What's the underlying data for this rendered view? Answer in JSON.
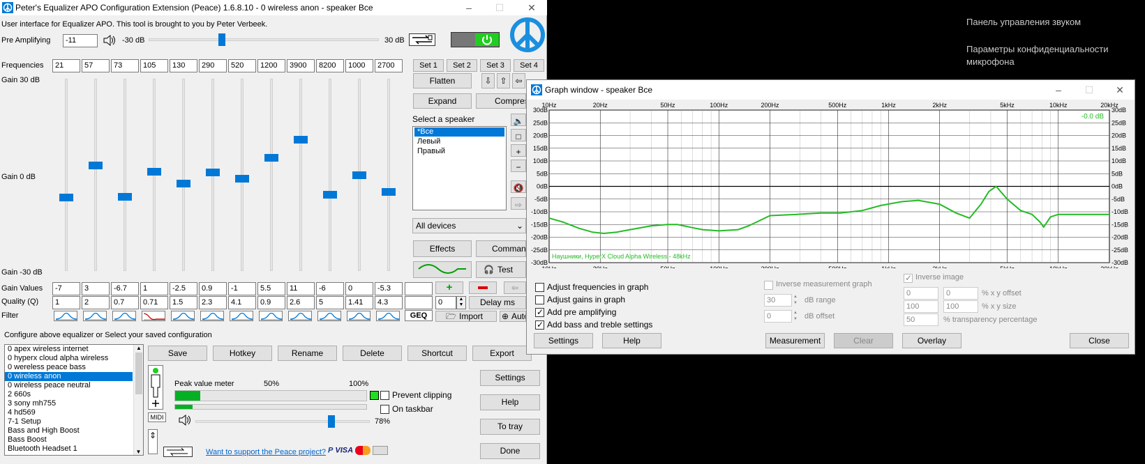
{
  "background": {
    "items": [
      "Панель управления звуком",
      "Параметры конфиденциальности микрофона"
    ]
  },
  "main": {
    "title": "Peter's Equalizer APO Configuration Extension (Peace) 1.6.8.10 - 0 wireless anon - speaker Все",
    "intro": "User interface for Equalizer APO. This tool is brought to you by Peter Verbeek.",
    "preamp": {
      "label": "Pre Amplifying",
      "value": "-11",
      "min_label": "-30 dB",
      "max_label": "30 dB",
      "level": -11,
      "min": -30,
      "max": 30
    },
    "frequencies_label": "Frequencies",
    "frequencies": [
      "21",
      "57",
      "73",
      "105",
      "130",
      "290",
      "520",
      "1200",
      "3900",
      "8200",
      "1000",
      "2700"
    ],
    "gain_labels": {
      "top": "Gain 30 dB",
      "mid": "Gain 0 dB",
      "bottom": "Gain -30 dB"
    },
    "gains": [
      -7,
      3,
      -6.7,
      1,
      -2.5,
      0.9,
      -1,
      5.5,
      11,
      -6,
      0,
      -5.3
    ],
    "gain_values_label": "Gain Values",
    "gain_values": [
      "-7",
      "3",
      "-6.7",
      "1",
      "-2.5",
      "0.9",
      "-1",
      "5.5",
      "11",
      "-6",
      "0",
      "-5.3"
    ],
    "quality_label": "Quality (Q)",
    "quality_values": [
      "1",
      "2",
      "0.7",
      "0.71",
      "1.5",
      "2.3",
      "4.1",
      "0.9",
      "2.6",
      "5",
      "1.41",
      "4.3"
    ],
    "filter_label": "Filter",
    "set_buttons": [
      "Set 1",
      "Set 2",
      "Set 3",
      "Set 4"
    ],
    "flatten": "Flatten",
    "expand": "Expand",
    "compress": "Compress",
    "select_speaker": "Select a speaker",
    "speakers": [
      "*Все",
      "Левый",
      "Правый"
    ],
    "device_select": "All devices",
    "effects": "Effects",
    "commands": "Commands",
    "test": "Test",
    "stepper_value": "0",
    "delay": "Delay ms",
    "geq": "GEQ",
    "import": "Import",
    "auto": "Auto",
    "configure_label": "Configure above equalizer or Select your saved configuration",
    "configs": [
      "0 apex wireless internet",
      "0 hyperx cloud alpha wireless",
      "0 wereless peace bass",
      "0 wireless anon",
      "0 wireless peace neutral",
      "2 660s",
      "3 sony mh755",
      "4 hd569",
      "7-1 Setup",
      "Bass and High Boost",
      "Bass Boost",
      "Bluetooth Headset 1"
    ],
    "config_actions": [
      "Save",
      "Hotkey",
      "Rename",
      "Delete",
      "Shortcut",
      "Export"
    ],
    "peak_label": "Peak value meter",
    "peak_50": "50%",
    "peak_100": "100%",
    "peak_level": 0.13,
    "prevent_clipping": "Prevent clipping",
    "on_taskbar": "On taskbar",
    "midi": "MIDI",
    "volume_pct": "78%",
    "volume_level": 0.78,
    "support_link": "Want to support the Peace project?",
    "side_buttons": [
      "Settings",
      "Help",
      "To tray",
      "Done"
    ]
  },
  "graph": {
    "title": "Graph window - speaker Все",
    "freq_ticks": [
      "10Hz",
      "20Hz",
      "50Hz",
      "100Hz",
      "200Hz",
      "500Hz",
      "1kHz",
      "2kHz",
      "5kHz",
      "10kHz",
      "20kHz"
    ],
    "db_ticks": [
      "30dB",
      "25dB",
      "20dB",
      "15dB",
      "10dB",
      "5dB",
      "0dB",
      "-5dB",
      "-10dB",
      "-15dB",
      "-20dB",
      "-25dB",
      "-30dB"
    ],
    "current_db": "-0.0 dB",
    "device_label": "Наушники, HyperX Cloud Alpha Wireless - 48kHz",
    "options": [
      {
        "label": "Adjust frequencies in graph",
        "checked": false
      },
      {
        "label": "Adjust gains in graph",
        "checked": false
      },
      {
        "label": "Add pre amplifying",
        "checked": true
      },
      {
        "label": "Add bass and treble settings",
        "checked": true
      }
    ],
    "inverse_measurement": "Inverse measurement graph",
    "db_range_value": "30",
    "db_range": "dB range",
    "db_offset_value": "0",
    "db_offset": "dB offset",
    "inverse_image": "Inverse image",
    "xy_offset": [
      "0",
      "0"
    ],
    "xy_offset_label": "% x y offset",
    "xy_size": [
      "100",
      "100"
    ],
    "xy_size_label": "% x y size",
    "transparency": "50",
    "transparency_label": "% transparency percentage",
    "buttons": {
      "settings": "Settings",
      "help": "Help",
      "measurement": "Measurement",
      "clear": "Clear",
      "overlay": "Overlay",
      "close": "Close"
    },
    "colors": {
      "curve": "#22bb22",
      "accent": "#0078d7"
    }
  },
  "chart_data": {
    "type": "line",
    "title": "",
    "xlabel": "",
    "ylabel": "",
    "x_scale": "log",
    "xlim": [
      10,
      20000
    ],
    "ylim": [
      -30,
      30
    ],
    "grid": true,
    "series": [
      {
        "x": [
          10,
          12,
          15,
          18,
          21,
          25,
          30,
          40,
          50,
          57,
          73,
          80,
          100,
          130,
          150,
          200,
          290,
          400,
          520,
          700,
          900,
          1200,
          1500,
          2000,
          2500,
          3000,
          3500,
          3900,
          4300,
          5000,
          6000,
          7000,
          7800,
          8200,
          9000,
          10000,
          12000,
          15000,
          20000
        ],
        "y": [
          -12.5,
          -14,
          -16.5,
          -18,
          -18.5,
          -18,
          -17,
          -15.5,
          -15,
          -15,
          -16.5,
          -17,
          -17.5,
          -17,
          -15.5,
          -11.5,
          -11,
          -10.5,
          -10.5,
          -9.5,
          -7.5,
          -6,
          -5.5,
          -7,
          -10.5,
          -12.5,
          -7,
          -2,
          0,
          -5,
          -9.5,
          -11,
          -14,
          -16,
          -12,
          -11,
          -11,
          -11,
          -11
        ]
      }
    ]
  }
}
